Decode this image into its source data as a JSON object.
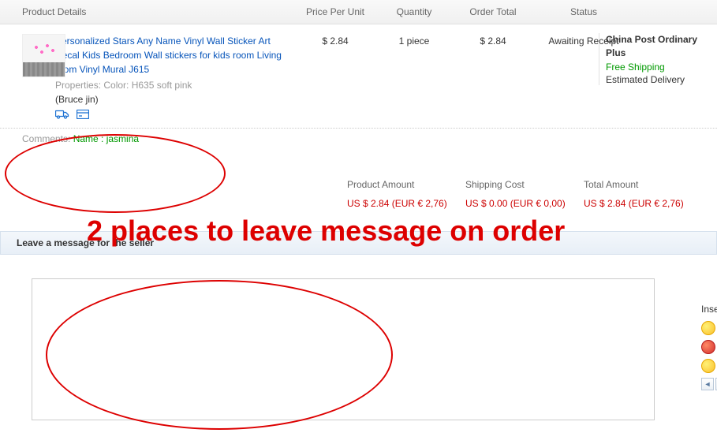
{
  "headers": {
    "product": "Product Details",
    "price": "Price Per Unit",
    "qty": "Quantity",
    "total": "Order Total",
    "status": "Status"
  },
  "product": {
    "title": "Personalized Stars Any Name Vinyl Wall Sticker Art Decal Kids Bedroom Wall stickers for kids room Living room Vinyl Mural J615",
    "properties": "Properties: Color: H635 soft pink",
    "seller": "(Bruce jin)",
    "price": "$ 2.84",
    "qty": "1 piece",
    "total": "$ 2.84",
    "status": "Awaiting Receipt"
  },
  "shipping": {
    "carrier": "China Post Ordinary Plus",
    "free": "Free Shipping",
    "estimated": "Estimated Delivery"
  },
  "comments": {
    "label": "Comments:",
    "value": "Name : jasmina"
  },
  "totals": {
    "product_label": "Product Amount",
    "product_value": "US $ 2.84 (EUR € 2,76)",
    "shipping_label": "Shipping Cost",
    "shipping_value": "US $ 0.00 (EUR € 0,00)",
    "total_label": "Total Amount",
    "total_value": "US $ 2.84 (EUR € 2,76)"
  },
  "msg": {
    "header": "Leave a message for the seller",
    "placeholder": ""
  },
  "insert": {
    "title": "Insert"
  },
  "annotation": "2 places to leave message on order"
}
